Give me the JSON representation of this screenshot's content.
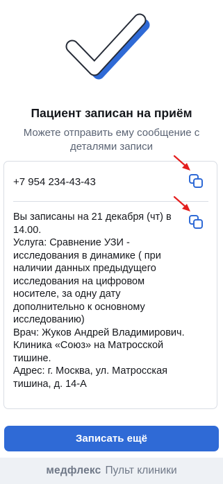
{
  "success": {
    "icon": "checkmark-icon",
    "title": "Пациент записан на приём",
    "subtitle": "Можете отправить ему сообщение с деталями записи"
  },
  "details": {
    "phone": "+7 954 234-43-43",
    "message": "Вы записаны на 21 декабря (чт) в 14.00.\nУслуга: Сравнение УЗИ - исследования в динамике ( при наличии данных предыдущего исследования на цифровом носителе, за одну дату дополнительно к основному исследованию)\nВрач: Жуков Андрей Владимирович.\nКлиника «Союз» на Матросской тишине.\nАдрес: г. Москва, ул. Матросская тишина, д. 14-А",
    "copy_icon": "copy-icon",
    "annotation_icon": "red-arrow-icon"
  },
  "actions": {
    "primary_label": "Записать ещё"
  },
  "footer": {
    "brand": "медфлекс",
    "label": "Пульт клиники"
  },
  "colors": {
    "accent": "#2f6ad6",
    "annotation": "#e41e1e",
    "footer_bg": "#eef1f5",
    "border": "#d9dde4"
  }
}
